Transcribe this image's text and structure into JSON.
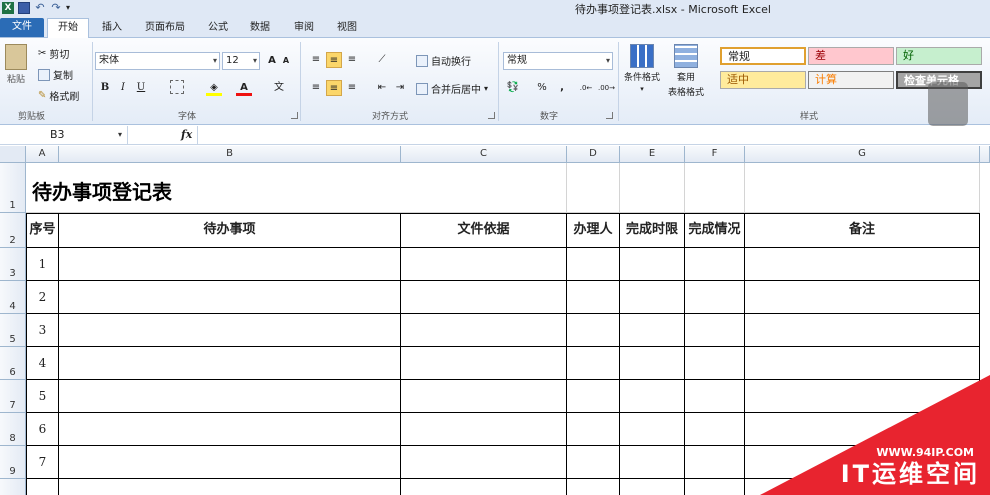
{
  "window": {
    "title": "待办事项登记表.xlsx - Microsoft Excel"
  },
  "tabs": [
    "文件",
    "开始",
    "插入",
    "页面布局",
    "公式",
    "数据",
    "审阅",
    "视图"
  ],
  "ribbon": {
    "clipboard": {
      "paste": "粘贴",
      "cut": "剪切",
      "copy": "复制",
      "format_painter": "格式刷",
      "label": "剪贴板"
    },
    "font": {
      "name": "宋体",
      "size": "12",
      "label": "字体",
      "bold": "B",
      "italic": "I",
      "underline": "U",
      "grow": "A",
      "shrink": "A",
      "font_color": "A",
      "phonetic": "文"
    },
    "alignment": {
      "wrap": "自动换行",
      "merge": "合并后居中",
      "label": "对齐方式"
    },
    "number": {
      "format": "常规",
      "percent": "%",
      "comma": ",",
      "label": "数字"
    },
    "styles": {
      "conditional": "条件格式",
      "table_format_1": "套用",
      "table_format_2": "表格格式",
      "label": "样式",
      "boxes": [
        {
          "text": "常规",
          "bg": "#ffffff",
          "fg": "#000000",
          "border": "#e0a030"
        },
        {
          "text": "差",
          "bg": "#ffc7ce",
          "fg": "#9c0006",
          "border": "#d8d8d8"
        },
        {
          "text": "好",
          "bg": "#c6efce",
          "fg": "#006100",
          "border": "#d8d8d8"
        },
        {
          "text": "适中",
          "bg": "#ffeb9c",
          "fg": "#9c5700",
          "border": "#d8d8d8"
        },
        {
          "text": "计算",
          "bg": "#f2f2f2",
          "fg": "#fa7d00",
          "border": "#7f7f7f"
        },
        {
          "text": "检查单元格",
          "bg": "#a5a5a5",
          "fg": "#ffffff",
          "border": "#3f3f3f"
        }
      ]
    }
  },
  "formula_bar": {
    "name_box": "B3",
    "fx": "fx",
    "content": ""
  },
  "columns": [
    "A",
    "B",
    "C",
    "D",
    "E",
    "F",
    "G"
  ],
  "rows": [
    "1",
    "2",
    "3",
    "4",
    "5",
    "6",
    "7",
    "8",
    "9"
  ],
  "sheet": {
    "title": "待办事项登记表",
    "headers": [
      "序号",
      "待办事项",
      "文件依据",
      "办理人",
      "完成时限",
      "完成情况",
      "备注"
    ],
    "serials": [
      "1",
      "2",
      "3",
      "4",
      "5",
      "6",
      "7"
    ]
  },
  "watermark": {
    "url": "WWW.94IP.COM",
    "name": "IT运维空间"
  }
}
